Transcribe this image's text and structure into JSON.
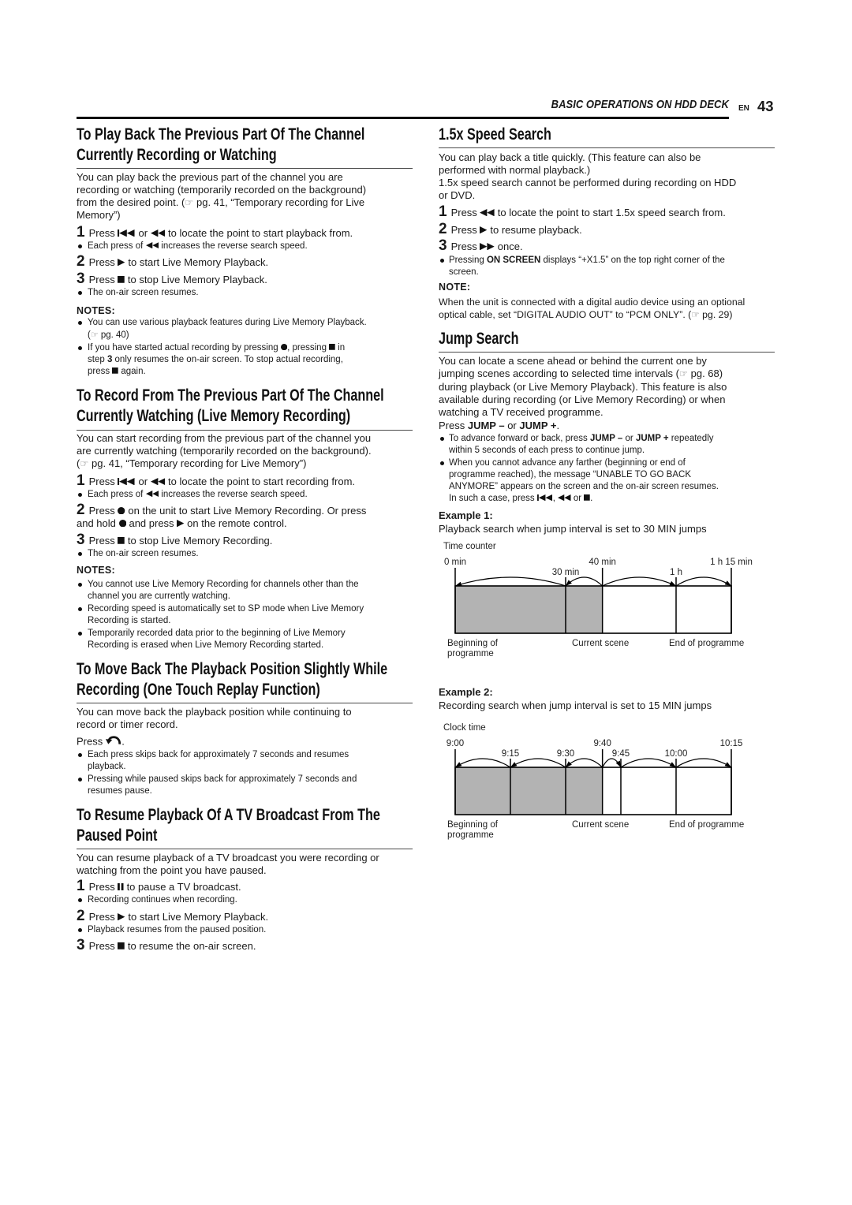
{
  "header": {
    "section_title": "BASIC OPERATIONS ON HDD DECK",
    "lang": "EN",
    "page_number": "43"
  },
  "live_playback": {
    "title": "To Play Back The Previous Part Of The Channel\nCurrently Recording or Watching",
    "intro": [
      "You can play back the previous part of the channel you are\nrecording or watching (temporarily recorded on the background)\nfrom the desired point. (",
      " pg. 41, “Temporary recording for Live\nMemory”)"
    ],
    "steps": [
      {
        "num": "1",
        "parts": [
          "Press ",
          " or ",
          " to locate the point to start playback from."
        ],
        "note": [
          "Each press of ",
          " increases the reverse search speed."
        ]
      },
      {
        "num": "2",
        "parts": [
          "Press ",
          " to start Live Memory Playback."
        ]
      },
      {
        "num": "3",
        "parts": [
          "Press ",
          " to stop Live Memory Playback."
        ],
        "note": [
          "The on-air screen resumes."
        ]
      }
    ],
    "notes_label": "NOTES:",
    "notes": [
      [
        "You can use various playback features during Live Memory Playback.\n(",
        " pg. 40)"
      ],
      [
        "If you have started actual recording by pressing ",
        ", pressing ",
        " in\nstep ",
        "3",
        " only resumes the on-air screen. To stop actual recording,\npress ",
        " again."
      ]
    ]
  },
  "live_recording": {
    "title": "To Record From The Previous Part Of The Channel\nCurrently Watching (Live Memory Recording)",
    "intro": [
      "You can start recording from the previous part of the channel you\nare currently watching (temporarily recorded on the background).\n(",
      " pg. 41, “Temporary recording for Live Memory”)"
    ],
    "steps": [
      {
        "num": "1",
        "parts": [
          "Press ",
          " or ",
          " to locate the point to start recording from."
        ],
        "note": [
          "Each press of ",
          " increases the reverse search speed."
        ]
      },
      {
        "num": "2",
        "parts": [
          "Press ",
          " on the unit to start Live Memory Recording. Or press\nand hold ",
          " and press ",
          " on the remote control."
        ]
      },
      {
        "num": "3",
        "parts": [
          "Press ",
          " to stop Live Memory Recording."
        ],
        "note": [
          "The on-air screen resumes."
        ]
      }
    ],
    "notes_label": "NOTES:",
    "notes": [
      "You cannot use Live Memory Recording for channels other than the\nchannel you are currently watching.",
      "Recording speed is automatically set to SP mode when Live Memory\nRecording is started.",
      "Temporarily recorded data prior to the beginning of Live Memory\nRecording is erased when Live Memory Recording started."
    ]
  },
  "one_touch_replay": {
    "title": "To Move Back The Playback Position Slightly While\nRecording (One Touch Replay Function)",
    "intro": "You can move back the playback position while continuing to\nrecord or timer record.",
    "press": [
      "Press ",
      "."
    ],
    "notes": [
      "Each press skips back for approximately 7 seconds and resumes\nplayback.",
      "Pressing while paused skips back for approximately 7 seconds and\nresumes pause."
    ]
  },
  "resume_broadcast": {
    "title": "To Resume Playback Of A TV Broadcast From The\nPaused Point",
    "intro": "You can resume playback of a TV broadcast you were recording or\nwatching from the point you have paused.",
    "steps": [
      {
        "num": "1",
        "parts": [
          "Press ",
          " to pause a TV broadcast."
        ],
        "note": "Recording continues when recording."
      },
      {
        "num": "2",
        "parts": [
          "Press ",
          " to start Live Memory Playback."
        ],
        "note": "Playback resumes from the paused position."
      },
      {
        "num": "3",
        "parts": [
          "Press ",
          " to resume the on-air screen."
        ]
      }
    ]
  },
  "speed_search": {
    "title": "1.5x Speed Search",
    "intro": "You can play back a title quickly. (This feature can also be\nperformed with normal playback.)\n1.5x speed search cannot be performed during recording on HDD\nor DVD.",
    "steps": [
      {
        "num": "1",
        "parts": [
          "Press ",
          " to locate the point to start 1.5x speed search from."
        ]
      },
      {
        "num": "2",
        "parts": [
          "Press ",
          " to resume playback."
        ]
      },
      {
        "num": "3",
        "parts": [
          "Press ",
          " once."
        ]
      }
    ],
    "bullet": [
      "Pressing ",
      "ON SCREEN",
      " displays “+X1.5” on the top right corner of the\nscreen."
    ],
    "note_label": "NOTE:",
    "note": [
      "When the unit is connected with a digital audio device using an optional\noptical cable, set “DIGITAL AUDIO OUT” to “PCM ONLY”. (",
      " pg. 29)"
    ]
  },
  "jump_search": {
    "title": "Jump Search",
    "intro": [
      "You can locate a scene ahead or behind the current one by\njumping scenes according to selected time intervals (",
      " pg. 68)\nduring playback (or Live Memory Playback). This feature is also\navailable during recording (or Live Memory Recording) or when\nwatching a TV received programme."
    ],
    "press": [
      "Press ",
      "JUMP –",
      " or ",
      "JUMP +",
      "."
    ],
    "notes": [
      [
        "To advance forward or back, press ",
        "JUMP –",
        " or ",
        "JUMP +",
        " repeatedly\nwithin 5 seconds of each press to continue jump."
      ],
      [
        "When you cannot advance any farther (beginning or end of\nprogramme reached), the message “UNABLE TO GO BACK\nANYMORE” appears on the screen and the on-air screen resumes.\nIn such a case, press ",
        ", ",
        " or ",
        "."
      ]
    ],
    "examples": [
      {
        "label": "Example 1:",
        "description": "Playback search when jump interval is set to 30 MIN jumps",
        "diagram": {
          "axis_label": "Time counter",
          "start_minutes": 0,
          "end_minutes": 75,
          "current_minutes": 40,
          "ticks": [
            {
              "label": "0 min",
              "minutes": 0,
              "major": true
            },
            {
              "label": "30 min",
              "minutes": 30,
              "major": false
            },
            {
              "label": "40 min",
              "minutes": 40,
              "major": true
            },
            {
              "label": "1 h",
              "minutes": 60,
              "major": false
            },
            {
              "label": "1 h 15 min",
              "minutes": 75,
              "major": true
            }
          ],
          "jumps": [
            {
              "from": 30,
              "to": 0
            },
            {
              "from": 40,
              "to": 30
            },
            {
              "from": 40,
              "to": 60
            },
            {
              "from": 60,
              "to": 75
            }
          ],
          "labels": {
            "start": "Beginning of\nprogramme",
            "current": "Current scene",
            "end": "End of programme"
          },
          "shade_color": "#b3b3b3"
        }
      },
      {
        "label": "Example 2:",
        "description": "Recording search when jump interval is set to 15 MIN jumps",
        "diagram": {
          "axis_label": "Clock time",
          "start_minutes": 0,
          "end_minutes": 75,
          "current_minutes": 40,
          "ticks": [
            {
              "label": "9:00",
              "minutes": 0,
              "major": true
            },
            {
              "label": "9:15",
              "minutes": 15,
              "major": false
            },
            {
              "label": "9:30",
              "minutes": 30,
              "major": false
            },
            {
              "label": "9:40",
              "minutes": 40,
              "major": true
            },
            {
              "label": "9:45",
              "minutes": 45,
              "major": false
            },
            {
              "label": "10:00",
              "minutes": 60,
              "major": false
            },
            {
              "label": "10:15",
              "minutes": 75,
              "major": true
            }
          ],
          "jumps": [
            {
              "from": 15,
              "to": 0
            },
            {
              "from": 30,
              "to": 15
            },
            {
              "from": 40,
              "to": 30
            },
            {
              "from": 40,
              "to": 45
            },
            {
              "from": 45,
              "to": 60
            },
            {
              "from": 60,
              "to": 75
            }
          ],
          "labels": {
            "start": "Beginning of\nprogramme",
            "current": "Current scene",
            "end": "End of programme"
          },
          "shade_color": "#b3b3b3"
        }
      }
    ]
  }
}
